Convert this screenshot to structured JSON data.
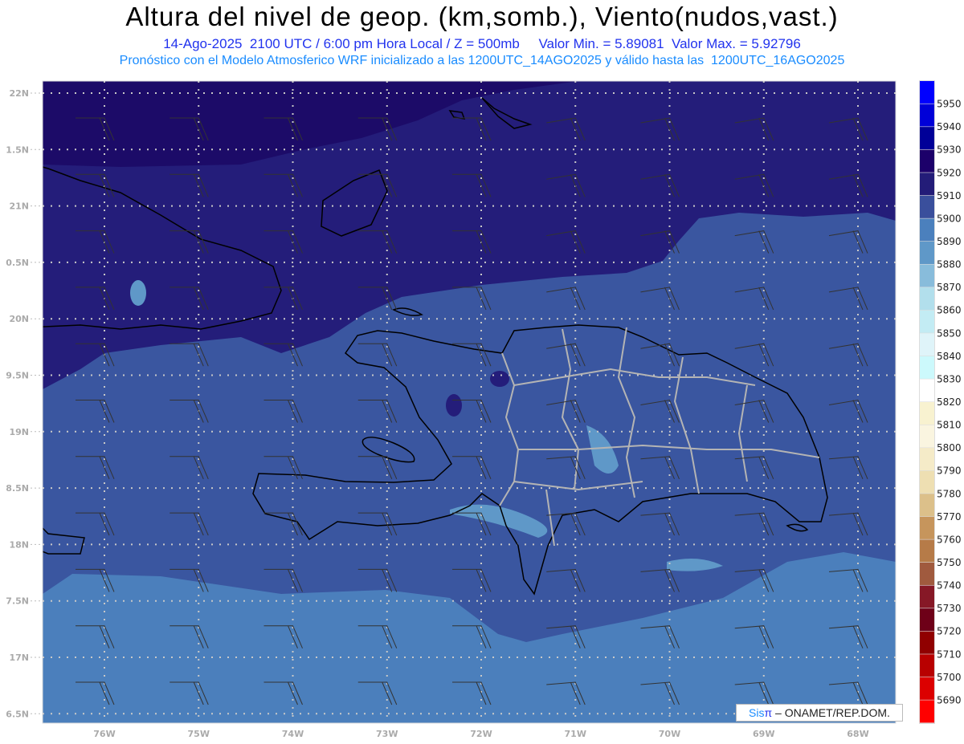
{
  "header": {
    "title": "Altura del nivel de geop. (km,somb.), Viento(nudos,vast.)",
    "info_line": "14-Ago-2025  2100 UTC / 6:00 pm Hora Local / Z = 500mb     Valor Min. = 5.89081  Valor Max. = 5.92796",
    "model_line": "Pronóstico con el Modelo Atmosferico WRF inicializado a las 1200UTC_14AGO2025 y válido hasta las  1200UTC_16AGO2025"
  },
  "map": {
    "lat_labels": [
      "22N",
      "1.5N",
      "21N",
      "0.5N",
      "20N",
      "9.5N",
      "19N",
      "8.5N",
      "18N",
      "7.5N",
      "17N",
      "6.5N"
    ],
    "lat_values": [
      22,
      21.5,
      21,
      20.5,
      20,
      19.5,
      19,
      18.5,
      18,
      17.5,
      17,
      16.5
    ],
    "lon_labels": [
      "76W",
      "75W",
      "74W",
      "73W",
      "72W",
      "71W",
      "70W",
      "69W",
      "68W"
    ],
    "lon_values": [
      -76,
      -75,
      -74,
      -73,
      -72,
      -71,
      -70,
      -69,
      -68
    ],
    "fill_colors": {
      "5920": "#1c0b68",
      "5910": "#241d7a",
      "5900": "#3a56a0",
      "5890": "#4b7fbc",
      "5880": "#5f98c8"
    },
    "coast_color": "#000000",
    "province_color": "#b4b4b4",
    "barb_color": "#333333"
  },
  "colorbar": {
    "labels": [
      "5950",
      "5940",
      "5930",
      "5920",
      "5910",
      "5900",
      "5890",
      "5880",
      "5870",
      "5860",
      "5850",
      "5840",
      "5830",
      "5820",
      "5810",
      "5800",
      "5790",
      "5780",
      "5770",
      "5760",
      "5750",
      "5740",
      "5730",
      "5720",
      "5710",
      "5700",
      "5690"
    ],
    "colors": [
      "#0000ff",
      "#0000d8",
      "#000098",
      "#1c006a",
      "#231c78",
      "#3a4f9c",
      "#4b80bd",
      "#5f98c8",
      "#88bcdb",
      "#b2dfec",
      "#c3ecf4",
      "#dff4f9",
      "#ccf9fc",
      "#ffffff",
      "#f8f2d0",
      "#faf5e0",
      "#f5ebc8",
      "#eedfb2",
      "#dcc08a",
      "#c6955c",
      "#b67b48",
      "#a05a3e",
      "#861826",
      "#6e0018",
      "#900000",
      "#b80000",
      "#dc0000",
      "#ff0000"
    ]
  },
  "credits": {
    "sis": "Sis",
    "pi": "π",
    "rest": " – ONAMET/REP.DOM."
  }
}
